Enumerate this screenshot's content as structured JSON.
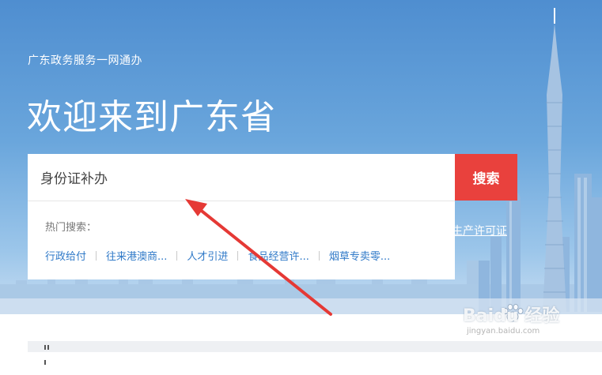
{
  "header": {
    "subtitle": "广东政务服务一网通办",
    "title": "欢迎来到广东省"
  },
  "search": {
    "value": "身份证补办",
    "button_label": "搜索"
  },
  "hot_search": {
    "label": "热门搜索：",
    "items": [
      "行政给付",
      "往来港澳商...",
      "人才引进",
      "食品经营许...",
      "烟草专卖零..."
    ]
  },
  "partial_link": "生产许可证",
  "watermark": {
    "brand": "Baidu 经验",
    "url": "jingyan.baidu.com"
  },
  "colors": {
    "search_button": "#e9413d",
    "hot_link": "#2f79c8",
    "arrow": "#e53935"
  }
}
